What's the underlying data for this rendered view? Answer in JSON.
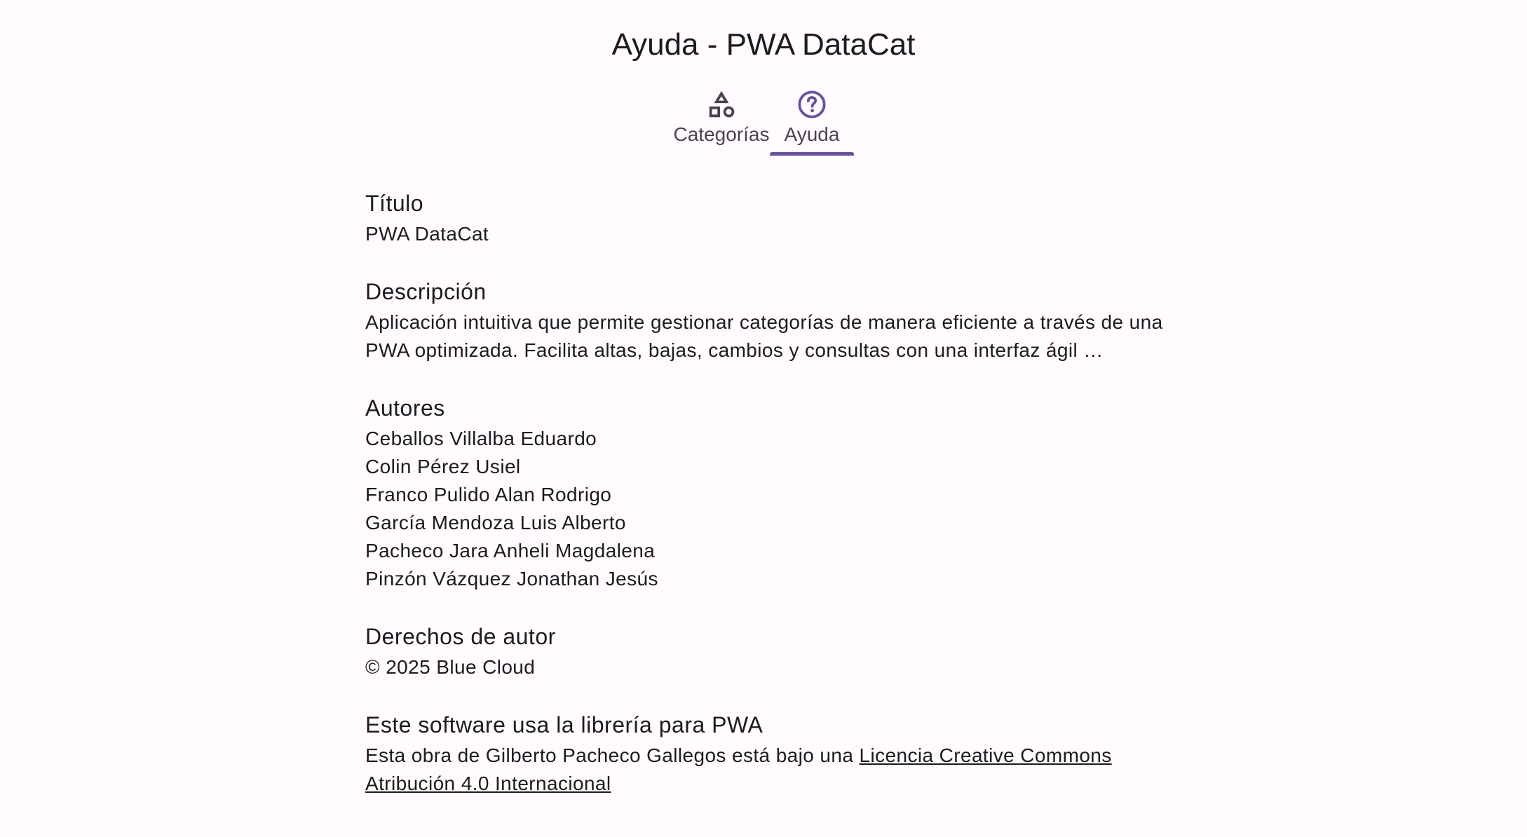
{
  "app": {
    "title": "Ayuda - PWA DataCat"
  },
  "tabs": [
    {
      "label": "Categorías",
      "icon": "category-shapes-icon",
      "selected": false
    },
    {
      "label": "Ayuda",
      "icon": "help-circle-icon",
      "selected": true
    }
  ],
  "colors": {
    "accent": "#6750a4",
    "background": "#fffbfe",
    "text": "#1c1b1f",
    "muted": "#49454f"
  },
  "sections": {
    "titulo": {
      "heading": "Título",
      "value": "PWA DataCat"
    },
    "descripcion": {
      "heading": "Descripción",
      "value": "Aplicación intuitiva que permite gestionar categorías de manera eficiente a través de una PWA optimizada. Facilita altas, bajas, cambios y consultas con una interfaz ágil …"
    },
    "autores": {
      "heading": "Autores",
      "items": [
        "Ceballos Villalba Eduardo",
        "Colin Pérez Usiel",
        "Franco Pulido Alan Rodrigo",
        "García Mendoza Luis Alberto",
        "Pacheco Jara Anheli Magdalena",
        "Pinzón Vázquez Jonathan Jesús"
      ]
    },
    "derechos": {
      "heading": "Derechos de autor",
      "value": "© 2025 Blue Cloud"
    },
    "libreria": {
      "heading": "Este software usa la librería para PWA",
      "text_before": "Esta obra de Gilberto Pacheco Gallegos está bajo una ",
      "link_text": "Licencia Creative Commons Atribución 4.0 Internacional"
    }
  }
}
